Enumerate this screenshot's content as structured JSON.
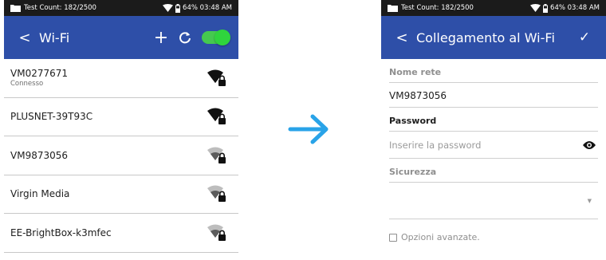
{
  "left_screen": {
    "status": {
      "test_count": "Test Count: 182/2500",
      "battery_time": "64% 03:48 AM"
    },
    "appbar": {
      "back_glyph": "<",
      "title": "Wi-Fi",
      "add_glyph": "+",
      "toggle_state": "on"
    },
    "networks": [
      {
        "ssid": "VM0277671",
        "status": "Connesso",
        "signal_strength": "strong",
        "secured": true
      },
      {
        "ssid": "PLUSNET-39T93C",
        "status": "",
        "signal_strength": "strong",
        "secured": true
      },
      {
        "ssid": "VM9873056",
        "status": "",
        "signal_strength": "medium",
        "secured": true
      },
      {
        "ssid": "Virgin Media",
        "status": "",
        "signal_strength": "medium",
        "secured": true
      },
      {
        "ssid": "EE-BrightBox-k3mfec",
        "status": "",
        "signal_strength": "medium",
        "secured": true
      }
    ]
  },
  "right_screen": {
    "status": {
      "test_count": "Test Count: 182/2500",
      "battery_time": "64% 03:48 AM"
    },
    "appbar": {
      "back_glyph": "<",
      "title": "Collegamento al Wi-Fi",
      "confirm_glyph": "✓"
    },
    "form": {
      "network_name_label": "Nome rete",
      "network_name_value": "VM9873056",
      "password_label": "Password",
      "password_placeholder": "Inserire la password",
      "security_label": "Sicurezza",
      "security_value": "",
      "advanced_options_label": "Opzioni avanzate."
    }
  },
  "colors": {
    "appbar": "#2e4fa8",
    "statusbar": "#1b1b1b",
    "toggle_on": "#2fd43d",
    "arrow": "#29a3e8"
  },
  "icons": [
    "folder-icon",
    "wifi-status-icon",
    "battery-icon",
    "refresh-icon",
    "wifi-signal-lock-icon",
    "eye-icon",
    "right-arrow-icon",
    "checkmark-icon"
  ]
}
